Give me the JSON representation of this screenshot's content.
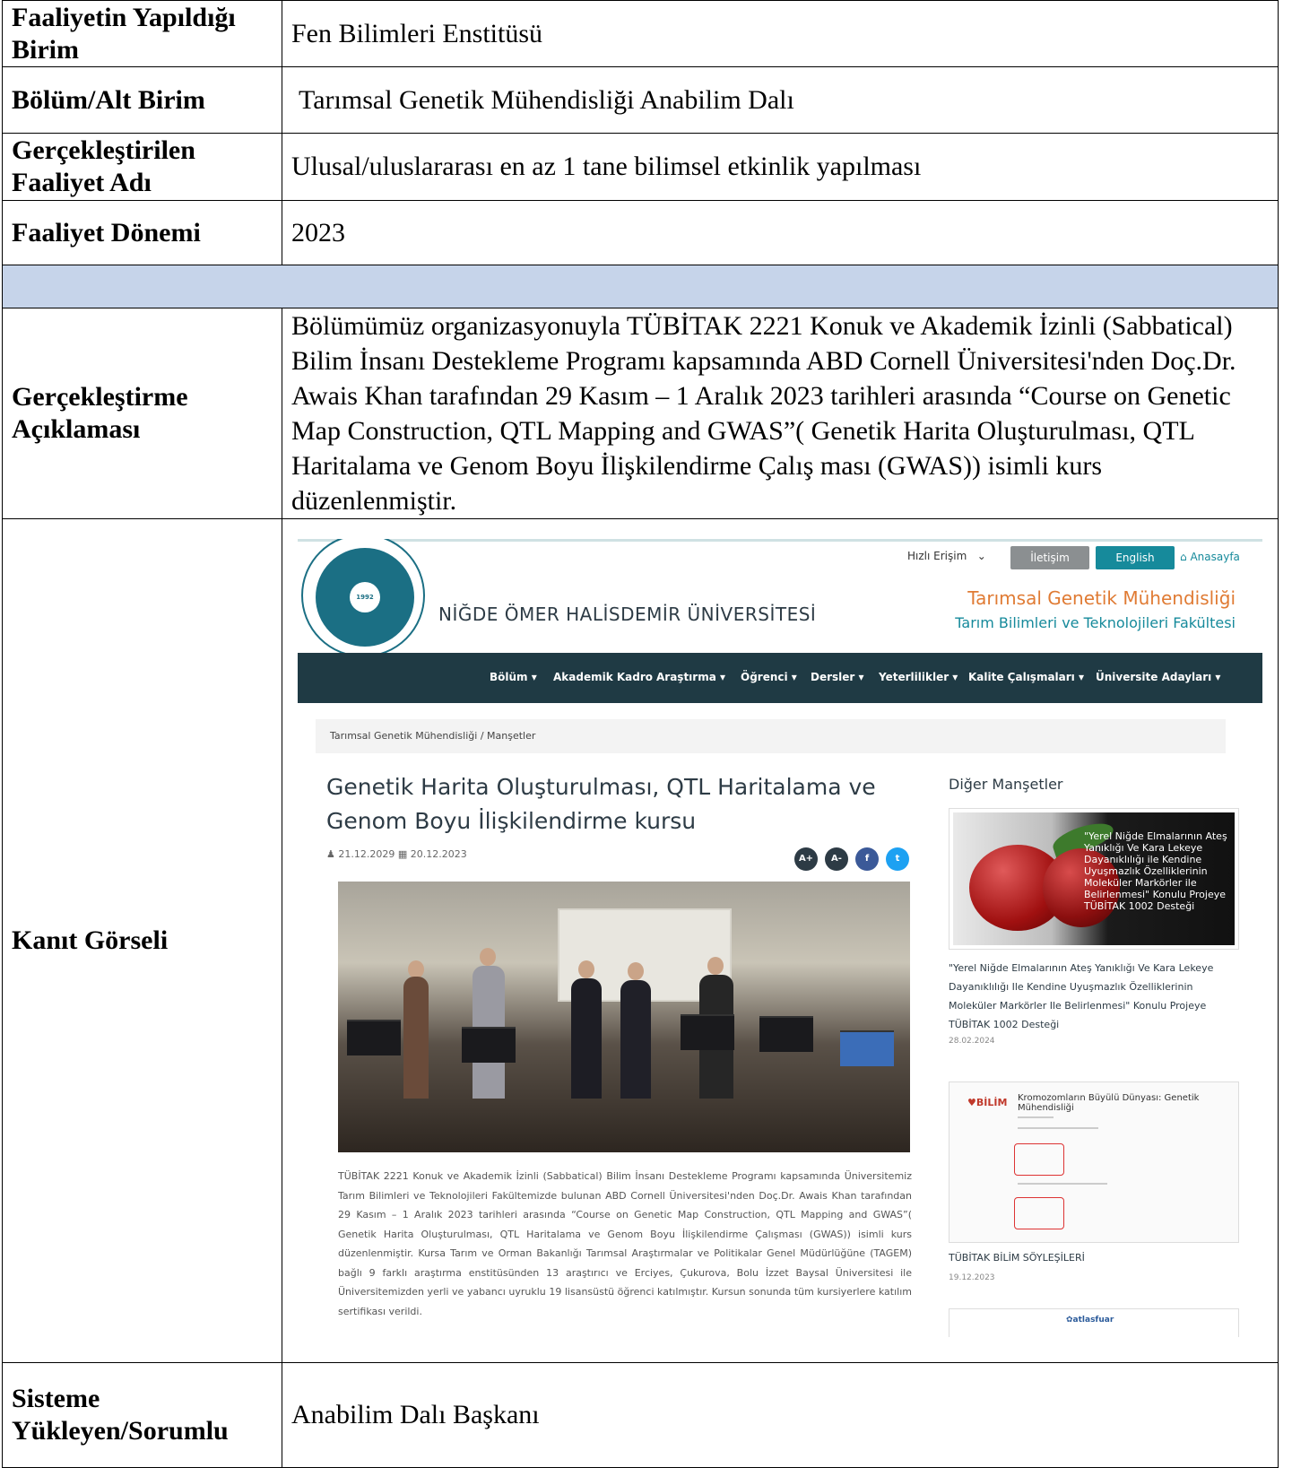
{
  "rows": {
    "unit_label": "Faaliyetin Yapıldığı Birim",
    "unit_value": "Fen Bilimleri Enstitüsü",
    "dept_label": "Bölüm/Alt Birim",
    "dept_value": "Tarımsal Genetik Mühendisliği Anabilim Dalı",
    "activity_label": "Gerçekleştirilen Faaliyet Adı",
    "activity_value": "Ulusal/uluslararası en az 1 tane bilimsel etkinlik yapılması",
    "period_label": "Faaliyet Dönemi",
    "period_value": "2023",
    "desc_label": "Gerçekleştirme Açıklaması",
    "desc_value": "Bölümümüz organizasyonuyla TÜBİTAK 2221 Konuk ve Akademik İzinli (Sabbatical) Bilim İnsanı Destekleme Programı kapsamında ABD Cornell Üniversitesi'nden Doç.Dr. Awais Khan tarafından 29 Kasım – 1 Aralık 2023 tarihleri arasında “Course on Genetic Map Construction, QTL Mapping and GWAS”( Genetik Harita Oluşturulması, QTL Haritalama ve Genom Boyu İlişkilendirme Çalış ması (GWAS)) isimli kurs düzenlenmiştir.",
    "evidence_label": "Kanıt Görseli",
    "uploader_label": "Sisteme Yükleyen/Sorumlu",
    "uploader_value": "Anabilim Dalı Başkanı"
  },
  "web": {
    "logo_year": "1992",
    "university": "NİĞDE ÖMER HALİSDEMİR ÜNİVERSİTESİ",
    "quick_access": "Hızlı Erişim",
    "contact_button": "İletişim",
    "english_button": "English",
    "home_link": "Anasayfa",
    "dept_name": "Tarımsal Genetik Mühendisliği",
    "faculty_name": "Tarım Bilimleri ve Teknolojileri Fakültesi",
    "nav": [
      "Bölüm ▾",
      "Akademik Kadro",
      "Araştırma ▾",
      "Öğrenci ▾",
      "Dersler ▾",
      "Yeterlilikler ▾",
      "Kalite Çalışmaları ▾",
      "Üniversite Adayları ▾"
    ],
    "breadcrumb": "Tarımsal Genetik Mühendisliği  /  Manşetler",
    "article_title": "Genetik Harita Oluşturulması, QTL Haritalama ve Genom Boyu İlişkilendirme kursu",
    "article_dates": "♟ 21.12.2029   ▦ 20.12.2023",
    "share": [
      "A+",
      "A-",
      "f",
      "t"
    ],
    "article_body": "TÜBİTAK 2221 Konuk ve Akademik İzinli (Sabbatical) Bilim İnsanı Destekleme Programı kapsamında Üniversitemiz Tarım Bilimleri ve Teknolojileri Fakültemizde bulunan ABD Cornell Üniversitesi'nden Doç.Dr. Awais Khan tarafından 29 Kasım – 1 Aralık 2023 tarihleri arasında “Course on Genetic Map Construction, QTL Mapping and GWAS”( Genetik Harita Oluşturulması, QTL Haritalama ve Genom Boyu İlişkilendirme Çalışması (GWAS)) isimli kurs düzenlenmiştir. Kursa Tarım ve Orman Bakanlığı Tarımsal Araştırmalar ve Politikalar Genel Müdürlüğüne (TAGEM) bağlı 9 farklı araştırma enstitüsünden 13 araştırıcı ve Erciyes, Çukurova, Bolu İzzet Baysal Üniversitesi ile Üniversitemizden yerli ve yabancı uyruklu 19 lisansüstü öğrenci katılmıştır. Kursun sonunda tüm kursiyerlere katılım sertifikası verildi.",
    "sidebar_heading": "Diğer Manşetler",
    "card1_image_text": "\"Yerel Niğde Elmalarının Ateş Yanıklığı Ve Kara Lekeye Dayanıklılığı ile Kendine Uyuşmazlık Özelliklerinin Moleküler Markörler ile Belirlenmesi\" Konulu Projeye TÜBİTAK 1002 Desteği",
    "card1_title": "\"Yerel Niğde Elmalarının Ateş Yanıklığı Ve Kara Lekeye Dayanıklılığı Ile Kendine Uyuşmazlık Özelliklerinin Moleküler Markörler Ile Belirlenmesi\" Konulu Projeye TÜBİTAK 1002 Desteği",
    "card1_date": "28.02.2024",
    "card2_logo": "♥BİLİM",
    "card2_title": "Kromozomların Büyülü Dünyası: Genetik Mühendisliği",
    "card2_caption": "TÜBİTAK BİLİM SÖYLEŞİLERİ",
    "card2_date": "19.12.2023",
    "card3_logo": "✿atlasfuar"
  }
}
